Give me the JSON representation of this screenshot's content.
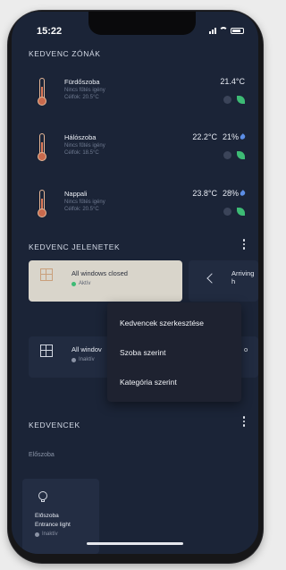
{
  "status": {
    "time": "15:22"
  },
  "favorite_zones": {
    "title": "KEDVENC ZÓNÁK",
    "rooms": [
      {
        "name": "Fürdőszoba",
        "status": "Nincs fűtés igény",
        "target": "Célfok: 20.5°C",
        "temperature": "21.4°C",
        "humidity": ""
      },
      {
        "name": "Hálószoba",
        "status": "Nincs fűtés igény",
        "target": "Célfok: 18.5°C",
        "temperature": "22.2°C",
        "humidity": "21%"
      },
      {
        "name": "Nappali",
        "status": "Nincs fűtés igény",
        "target": "Célfok: 20.5°C",
        "temperature": "23.8°C",
        "humidity": "28%"
      }
    ]
  },
  "favorite_scenes": {
    "title": "KEDVENC JELENETEK",
    "scenes": [
      {
        "label": "All windows closed",
        "status": "Aktív",
        "status_color": "#3dbb75"
      },
      {
        "label": "Arriving h",
        "status": ""
      },
      {
        "label": "All windov",
        "status": "Inaktív",
        "status_color": "#8b93a5"
      },
      {
        "label": "o",
        "status": ""
      }
    ]
  },
  "context_menu": {
    "items": [
      "Kedvencek szerkesztése",
      "Szoba szerint",
      "Kategória szerint"
    ]
  },
  "favorites": {
    "title": "KEDVENCEK",
    "group": "Előszoba",
    "device": {
      "room": "Előszoba",
      "name": "Entrance light",
      "status": "Inaktív"
    }
  },
  "colors": {
    "background": "#1b2437",
    "accent_green": "#3dbb75",
    "menu_bg": "#1e2230"
  }
}
